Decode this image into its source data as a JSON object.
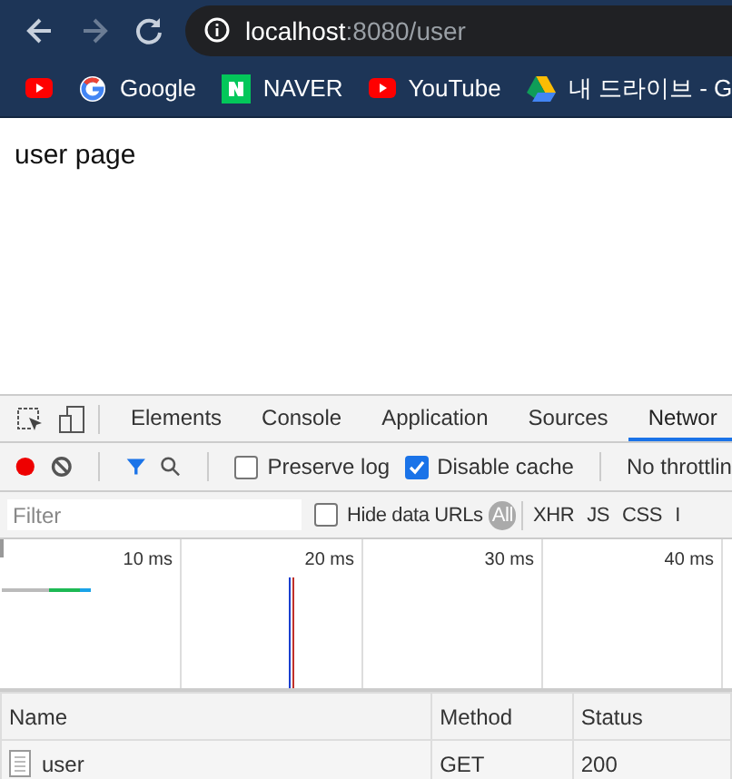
{
  "browser": {
    "address": {
      "host": "localhost",
      "rest": ":8080/user"
    },
    "bookmarks": [
      {
        "kind": "youtube"
      },
      {
        "kind": "google",
        "label": "Google"
      },
      {
        "kind": "naver",
        "label": "NAVER"
      },
      {
        "kind": "youtube",
        "label": "YouTube"
      },
      {
        "kind": "drive",
        "label": "내 드라이브 - G"
      }
    ]
  },
  "page": {
    "text": "user page"
  },
  "devtools": {
    "tabs": [
      {
        "label": "Elements",
        "selected": false
      },
      {
        "label": "Console",
        "selected": false
      },
      {
        "label": "Application",
        "selected": false
      },
      {
        "label": "Sources",
        "selected": false
      },
      {
        "label": "Networ",
        "selected": true
      }
    ],
    "recording": true,
    "preserve_log": {
      "label": "Preserve log",
      "checked": false
    },
    "disable_cache": {
      "label": "Disable cache",
      "checked": true
    },
    "throttling": "No throttlin",
    "filter": {
      "placeholder": "Filter"
    },
    "hide_data_urls": {
      "label": "Hide data URLs",
      "checked": false
    },
    "types": [
      {
        "label": "All",
        "selected": true
      },
      {
        "label": "XHR",
        "selected": false
      },
      {
        "label": "JS",
        "selected": false
      },
      {
        "label": "CSS",
        "selected": false
      },
      {
        "label": "I",
        "selected": false
      }
    ],
    "timeline_ticks": [
      "10 ms",
      "20 ms",
      "30 ms",
      "40 ms"
    ],
    "table": {
      "columns": [
        "Name",
        "Method",
        "Status"
      ],
      "rows": [
        {
          "name": "user",
          "method": "GET",
          "status": "200"
        }
      ]
    }
  }
}
